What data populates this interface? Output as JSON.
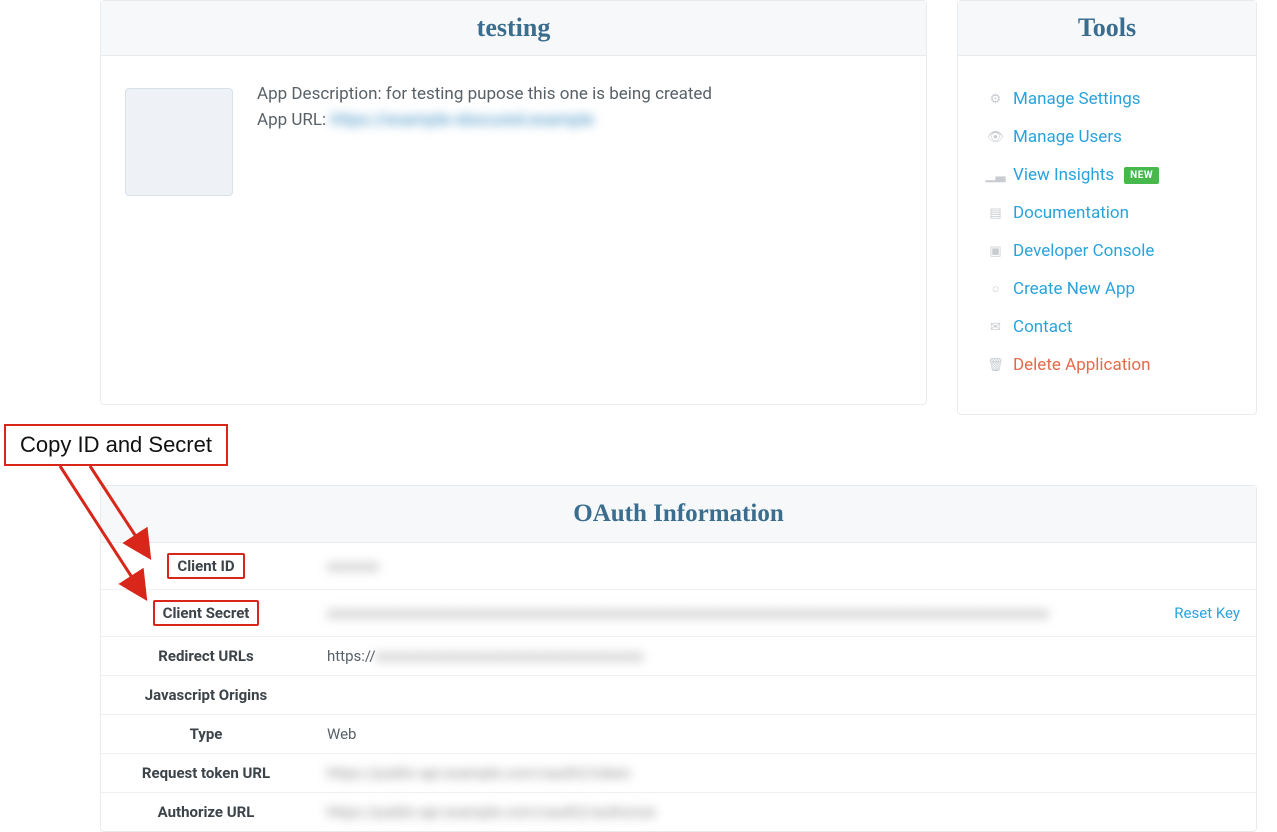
{
  "app": {
    "title": "testing",
    "description_label": "App Description:",
    "description_value": "for testing pupose this one is being created",
    "url_label": "App URL:",
    "url_value": "https://example-obscured.example"
  },
  "tools": {
    "title": "Tools",
    "items": [
      {
        "label": "Manage Settings",
        "icon": "gear",
        "danger": false,
        "badge": null
      },
      {
        "label": "Manage Users",
        "icon": "eye",
        "danger": false,
        "badge": null
      },
      {
        "label": "View Insights",
        "icon": "chart",
        "danger": false,
        "badge": "NEW"
      },
      {
        "label": "Documentation",
        "icon": "doc",
        "danger": false,
        "badge": null
      },
      {
        "label": "Developer Console",
        "icon": "console",
        "danger": false,
        "badge": null
      },
      {
        "label": "Create New App",
        "icon": "plus",
        "danger": false,
        "badge": null
      },
      {
        "label": "Contact",
        "icon": "mail",
        "danger": false,
        "badge": null
      },
      {
        "label": "Delete Application",
        "icon": "trash",
        "danger": true,
        "badge": null
      }
    ]
  },
  "oauth": {
    "title": "OAuth Information",
    "reset_label": "Reset Key",
    "rows": [
      {
        "key": "Client ID",
        "value": "xxxxxxx",
        "blurred": true,
        "highlight": true,
        "reset": false
      },
      {
        "key": "Client Secret",
        "value": "xxxxxxxxxxxxxxxxxxxxxxxxxxxxxxxxxxxxxxxxxxxxxxxxxxxxxxxxxxxxxxxxxxxxxxxxxxxxxxxxxxxxxxxxxxxxxxxxx",
        "blurred": true,
        "highlight": true,
        "reset": true
      },
      {
        "key": "Redirect URLs",
        "value": "https://xxxxxxxxxxxxxxxxxxxxxxxxxxxxxxxxxxxx",
        "blurred": true,
        "highlight": false,
        "reset": false,
        "prefix_clear": "https://"
      },
      {
        "key": "Javascript Origins",
        "value": "",
        "blurred": false,
        "highlight": false,
        "reset": false
      },
      {
        "key": "Type",
        "value": "Web",
        "blurred": false,
        "highlight": false,
        "reset": false
      },
      {
        "key": "Request token URL",
        "value": "https://public-api.example.com/oauth2/token",
        "blurred": true,
        "highlight": false,
        "reset": false
      },
      {
        "key": "Authorize URL",
        "value": "https://public-api.example.com/oauth2/authorize",
        "blurred": true,
        "highlight": false,
        "reset": false
      }
    ]
  },
  "annotation": {
    "label": "Copy ID and Secret"
  },
  "icons": {
    "gear": "⚙",
    "eye": "👁",
    "chart": "▁▃",
    "doc": "▤",
    "console": "▣",
    "plus": "○",
    "mail": "✉",
    "trash": "🗑"
  }
}
